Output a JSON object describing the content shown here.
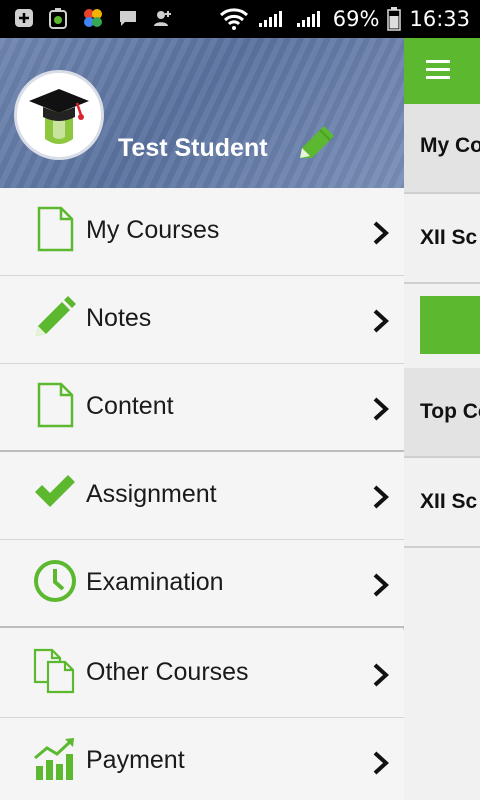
{
  "status_bar": {
    "battery": "69%",
    "time": "16:33"
  },
  "app": {
    "rows": [
      {
        "text": "My Co"
      },
      {
        "text": "XII Sc"
      },
      {
        "text": ""
      },
      {
        "text": "Top Co"
      },
      {
        "text": "XII Sc"
      }
    ]
  },
  "drawer": {
    "username": "Test Student",
    "items": [
      {
        "label": "My Courses",
        "icon": "document-icon"
      },
      {
        "label": "Notes",
        "icon": "pencil-icon"
      },
      {
        "label": "Content",
        "icon": "document-icon"
      },
      {
        "label": "Assignment",
        "icon": "check-icon"
      },
      {
        "label": "Examination",
        "icon": "clock-icon"
      },
      {
        "label": "Other Courses",
        "icon": "documents-icon"
      },
      {
        "label": "Payment",
        "icon": "chart-icon"
      }
    ]
  },
  "colors": {
    "accent": "#5cb82e",
    "header": "#6a80a9"
  }
}
